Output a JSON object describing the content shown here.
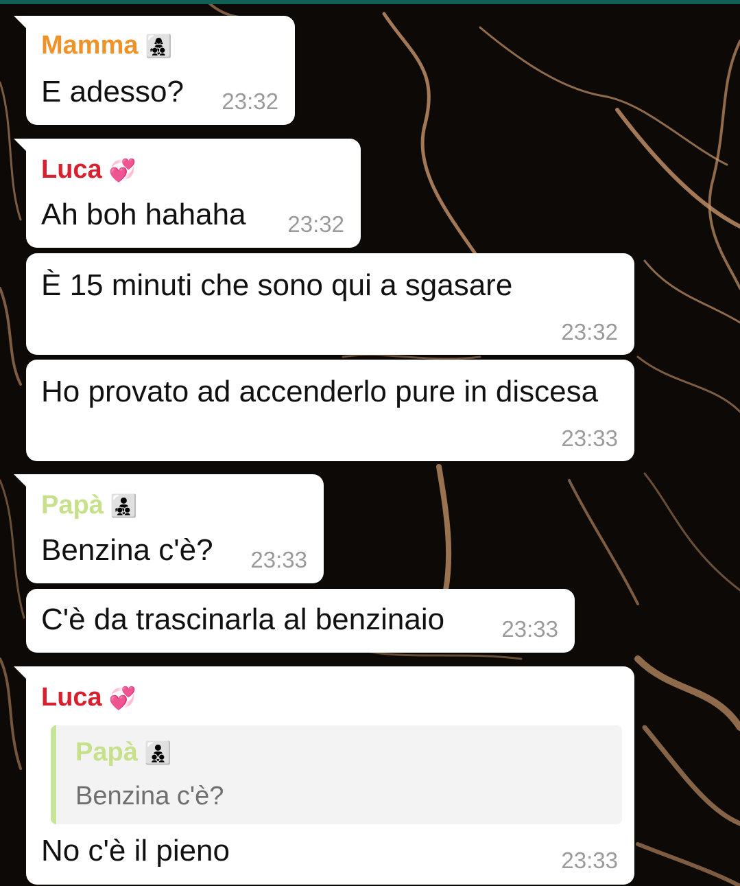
{
  "colors": {
    "header_bar": "#0f5f55",
    "bubble": "#ffffff",
    "mamma": "#f0922a",
    "luca": "#d8202e",
    "papa": "#c7e08a",
    "timestamp": "#9a9a9a",
    "quote_bar": "#c4e59a"
  },
  "messages": [
    {
      "sender": "Mamma",
      "sender_icon": "mother-with-children-emoji",
      "sender_emoji": "👩‍👧‍👦",
      "text": "E adesso?",
      "time": "23:32"
    },
    {
      "sender": "Luca",
      "sender_icon": "two-hearts-emoji",
      "sender_emoji": "💞",
      "text": "Ah boh hahaha",
      "time": "23:32"
    },
    {
      "text": "È 15 minuti che sono qui a sgasare",
      "time": "23:32"
    },
    {
      "text": "Ho provato ad accenderlo pure in discesa",
      "time": "23:33"
    },
    {
      "sender": "Papà",
      "sender_icon": "father-with-children-emoji",
      "sender_emoji": "👨‍👧‍👦",
      "text": "Benzina c'è?",
      "time": "23:33"
    },
    {
      "text": "C'è da trascinarla al benzinaio",
      "time": "23:33"
    },
    {
      "sender": "Luca",
      "sender_icon": "two-hearts-emoji",
      "sender_emoji": "💞",
      "quote": {
        "sender": "Papà",
        "sender_icon": "father-with-children-emoji",
        "sender_emoji": "👨‍👦‍👦",
        "text": "Benzina c'è?"
      },
      "text": "No c'è il pieno",
      "time": "23:33"
    }
  ]
}
